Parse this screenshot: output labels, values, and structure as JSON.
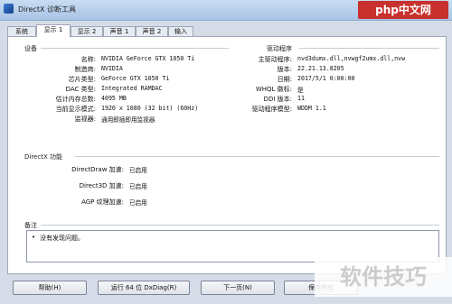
{
  "window": {
    "title": "DirectX 诊断工具"
  },
  "watermark_top": "php中文网",
  "tabs": [
    {
      "label": "系统"
    },
    {
      "label": "显示 1"
    },
    {
      "label": "显示 2"
    },
    {
      "label": "声音 1"
    },
    {
      "label": "声音 2"
    },
    {
      "label": "输入"
    }
  ],
  "device": {
    "heading": "设备",
    "rows": [
      {
        "label": "名称:",
        "value": "NVIDIA GeForce GTX 1050 Ti"
      },
      {
        "label": "制造商:",
        "value": "NVIDIA"
      },
      {
        "label": "芯片类型:",
        "value": "GeForce GTX 1050 Ti"
      },
      {
        "label": "DAC 类型:",
        "value": "Integrated RAMDAC"
      },
      {
        "label": "估计内存总数:",
        "value": "4095 MB"
      },
      {
        "label": "当前显示模式:",
        "value": "1920 x 1080 (32 bit) (60Hz)"
      },
      {
        "label": "监视器:",
        "value": "通用即插即用监视器"
      }
    ]
  },
  "drivers": {
    "heading": "驱动程序",
    "rows": [
      {
        "label": "主驱动程序:",
        "value": "nvd3dumx.dll,nvwgf2umx.dll,nvw"
      },
      {
        "label": "版本:",
        "value": "22.21.13.8205"
      },
      {
        "label": "日期:",
        "value": "2017/5/1 0:00:00"
      },
      {
        "label": "WHQL 徽标:",
        "value": "是"
      },
      {
        "label": "DDI 版本:",
        "value": "11"
      },
      {
        "label": "驱动程序模型:",
        "value": "WDDM 1.1"
      }
    ]
  },
  "directx_features": {
    "heading": "DirectX 功能",
    "rows": [
      {
        "label": "DirectDraw 加速:",
        "value": "已启用"
      },
      {
        "label": "Direct3D 加速:",
        "value": "已启用"
      },
      {
        "label": "AGP 纹理加速:",
        "value": "已启用"
      }
    ]
  },
  "notes": {
    "heading": "备注",
    "bullet": "•",
    "text": "没有发现问题。"
  },
  "buttons": {
    "help": "帮助(H)",
    "run64": "运行 64 位 DxDiag(R)",
    "next": "下一页(N)",
    "save": "保存所有"
  },
  "watermark_bottom": "软件技巧"
}
